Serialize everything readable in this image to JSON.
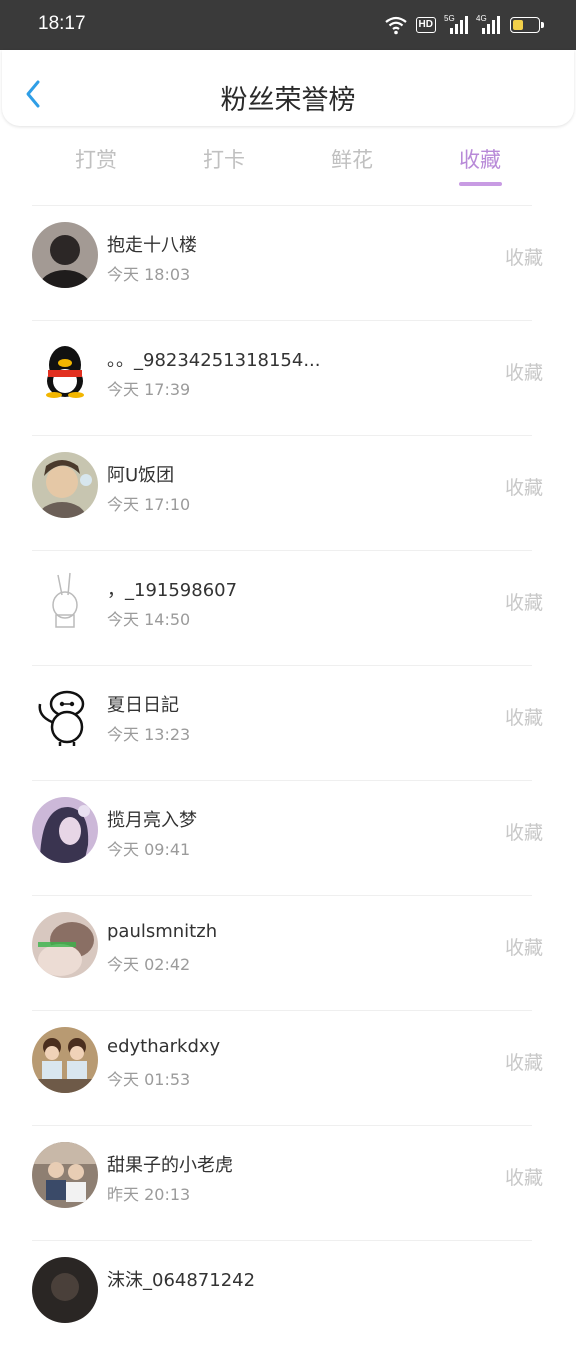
{
  "status_bar": {
    "time": "18:17",
    "hd_label": "HD",
    "sig1_label": "5G",
    "sig2_label": "4G"
  },
  "header": {
    "title": "粉丝荣誉榜",
    "back_icon": "chevron-left-icon"
  },
  "tabs": [
    {
      "label": "打赏",
      "active": false
    },
    {
      "label": "打卡",
      "active": false
    },
    {
      "label": "鲜花",
      "active": false
    },
    {
      "label": "收藏",
      "active": true
    }
  ],
  "accent_color": "#b88ad8",
  "fans": [
    {
      "name": "抱走十八楼",
      "time": "今天 18:03",
      "action": "收藏"
    },
    {
      "name": "。。_98234251318154...",
      "time": "今天 17:39",
      "action": "收藏"
    },
    {
      "name": "阿U饭团",
      "time": "今天 17:10",
      "action": "收藏"
    },
    {
      "name": "，_191598607",
      "time": "今天 14:50",
      "action": "收藏"
    },
    {
      "name": "夏日日記",
      "time": "今天 13:23",
      "action": "收藏"
    },
    {
      "name": "揽月亮入梦",
      "time": "今天 09:41",
      "action": "收藏"
    },
    {
      "name": "paulsmnitzh",
      "time": "今天 02:42",
      "action": "收藏"
    },
    {
      "name": "edytharkdxy",
      "time": "今天 01:53",
      "action": "收藏"
    },
    {
      "name": "甜果子的小老虎",
      "time": "昨天 20:13",
      "action": "收藏"
    },
    {
      "name": "沫沫_064871242",
      "time": "",
      "action": ""
    }
  ]
}
